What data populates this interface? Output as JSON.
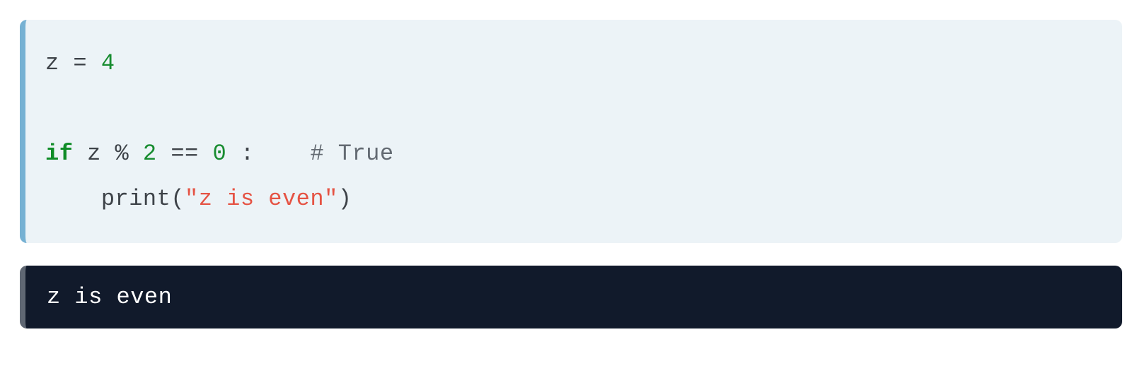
{
  "code": {
    "line1": {
      "var": "z ",
      "eq": "=",
      "sp": " ",
      "val": "4"
    },
    "line2_blank": "",
    "line3": {
      "kw": "if",
      "sp1": " ",
      "var": "z ",
      "mod": "%",
      "sp2": " ",
      "two": "2",
      "sp3": " ",
      "eqeq": "==",
      "sp4": " ",
      "zero": "0",
      "sp5": " ",
      "colon": ":",
      "gap": "    ",
      "comment": "# True"
    },
    "line4": {
      "indent": "    ",
      "fn": "print",
      "lp": "(",
      "str": "\"z is even\"",
      "rp": ")"
    }
  },
  "output": {
    "text": "z is even"
  }
}
